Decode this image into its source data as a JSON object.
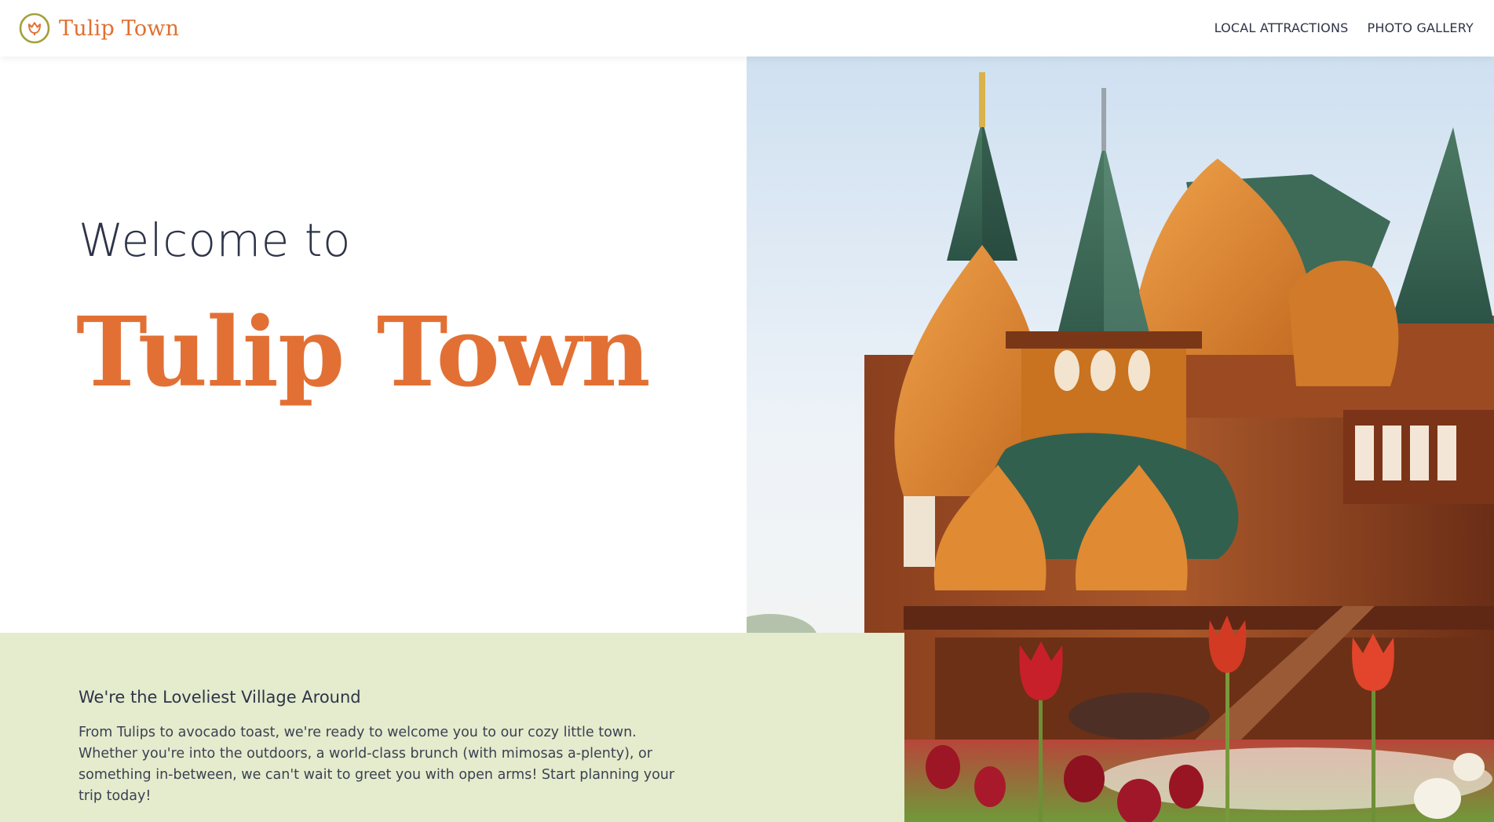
{
  "brand": {
    "name": "Tulip Town",
    "logo_icon": "tulip-logo-icon",
    "accent_color": "#e27034"
  },
  "nav": {
    "items": [
      {
        "label": "LOCAL ATTRACTIONS"
      },
      {
        "label": "PHOTO GALLERY"
      }
    ]
  },
  "hero": {
    "welcome": "Welcome to",
    "title": "Tulip Town",
    "photo": "wooden-palace-with-tulips-photo"
  },
  "info": {
    "heading": "We're the Loveliest Village Around",
    "body": "From Tulips to avocado toast, we're ready to welcome you to our cozy little town. Whether you're into the outdoors, a world-class brunch (with mimosas a-plenty), or something in-between, we can't wait to greet you with open arms! Start planning your trip today!",
    "background_color": "#e5eccd"
  }
}
